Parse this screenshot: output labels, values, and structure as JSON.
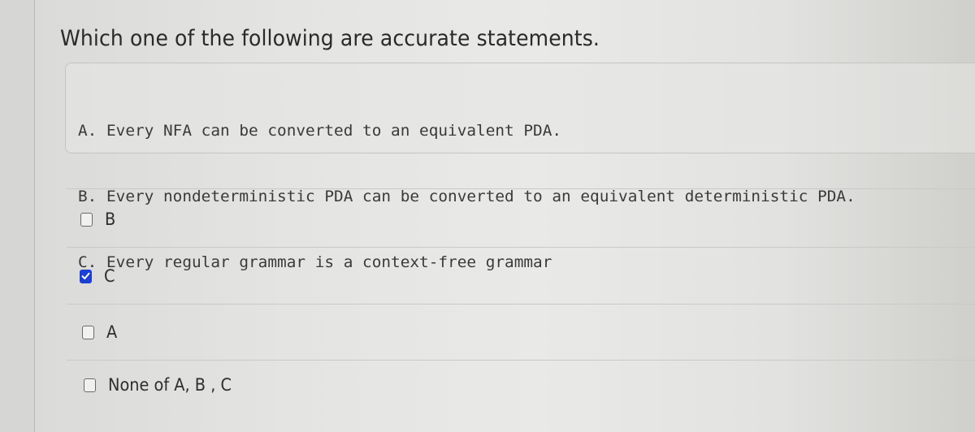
{
  "question": {
    "title": "Which one of the following are accurate statements."
  },
  "statements": [
    {
      "text": "A. Every NFA can be converted to an equivalent PDA."
    },
    {
      "text": "B. Every nondeterministic PDA can be converted to an equivalent deterministic PDA."
    },
    {
      "text": "C. Every regular grammar is a context-free grammar"
    }
  ],
  "options": [
    {
      "label": "B",
      "checked": false
    },
    {
      "label": "C",
      "checked": true
    },
    {
      "label": "A",
      "checked": false
    },
    {
      "label": "None of A, B , C",
      "checked": false
    }
  ],
  "colors": {
    "checkbox_checked": "#1a3ed6",
    "text": "#2b2b2b"
  }
}
